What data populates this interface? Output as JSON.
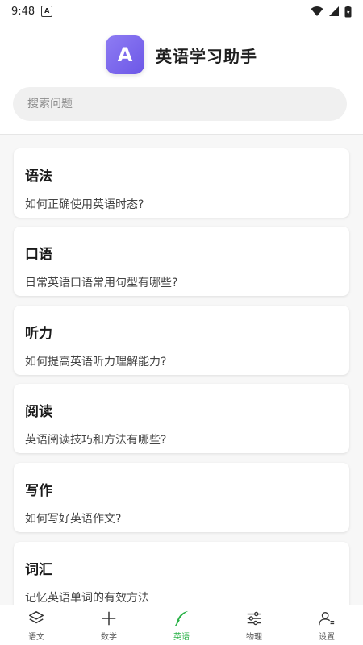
{
  "status_bar": {
    "time": "9:48",
    "notification_badge": "A"
  },
  "header": {
    "logo_letter": "A",
    "title": "英语学习助手"
  },
  "search": {
    "placeholder": "搜索问题",
    "value": ""
  },
  "questions": [
    {
      "category": "语法",
      "question": "如何正确使用英语时态?"
    },
    {
      "category": "口语",
      "question": "日常英语口语常用句型有哪些?"
    },
    {
      "category": "听力",
      "question": "如何提高英语听力理解能力?"
    },
    {
      "category": "阅读",
      "question": "英语阅读技巧和方法有哪些?"
    },
    {
      "category": "写作",
      "question": "如何写好英语作文?"
    },
    {
      "category": "词汇",
      "question": "记忆英语单词的有效方法"
    }
  ],
  "tabs": [
    {
      "label": "语文",
      "icon": "layers-icon"
    },
    {
      "label": "数学",
      "icon": "plus-icon"
    },
    {
      "label": "英语",
      "icon": "feather-icon",
      "active": true
    },
    {
      "label": "物理",
      "icon": "sliders-icon"
    },
    {
      "label": "设置",
      "icon": "user-settings-icon"
    }
  ],
  "colors": {
    "accent": "#27b145",
    "logo": "#7b68ee"
  }
}
